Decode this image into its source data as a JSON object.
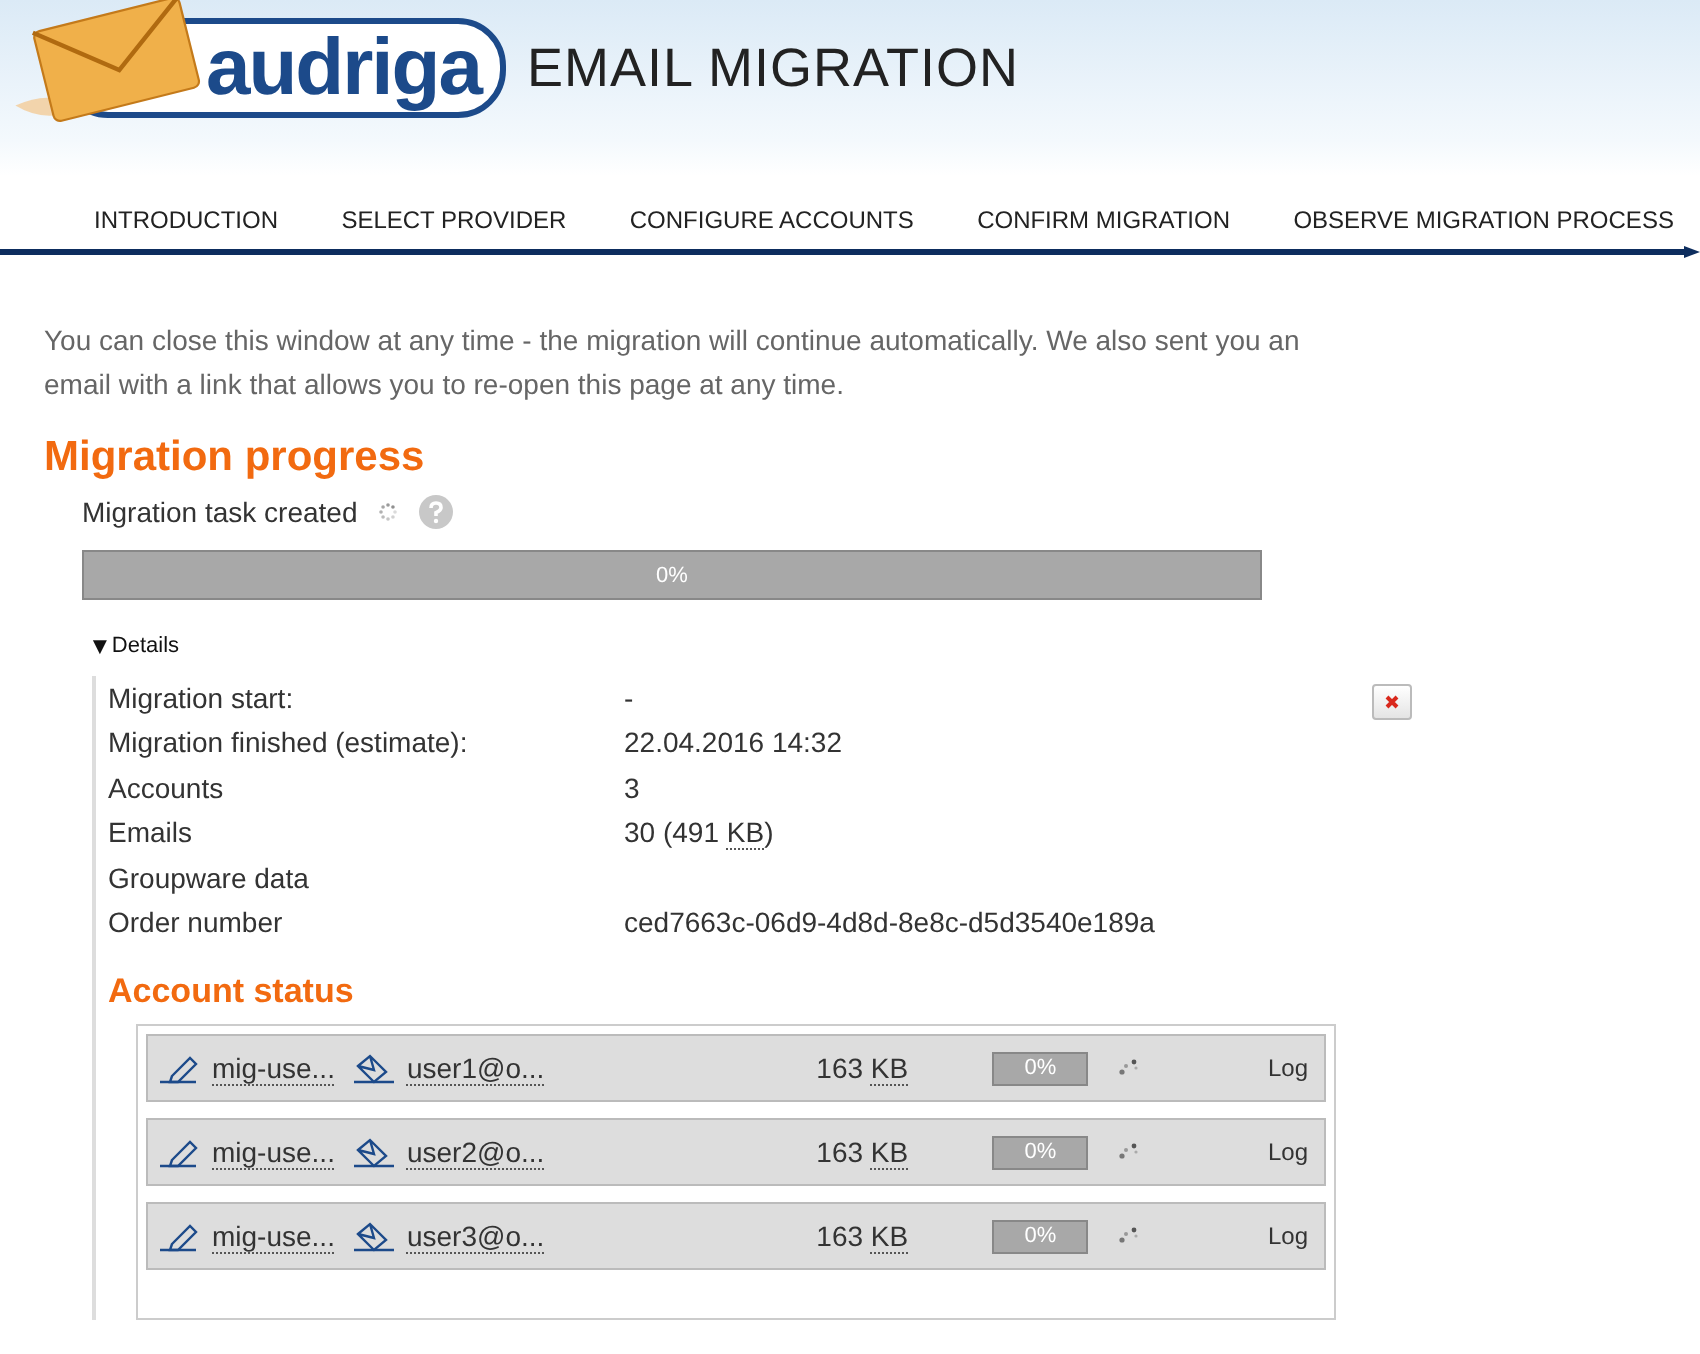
{
  "header": {
    "logo": "audriga",
    "title": "EMAIL MIGRATION"
  },
  "steps": [
    {
      "label": "INTRODUCTION"
    },
    {
      "label": "SELECT PROVIDER"
    },
    {
      "label": "CONFIGURE ACCOUNTS"
    },
    {
      "label": "CONFIRM MIGRATION"
    },
    {
      "label": "OBSERVE MIGRATION PROCESS"
    }
  ],
  "intro": "You can close this window at any time - the migration will continue automatically. We also sent you an email with a link that allows you to re-open this page at any time.",
  "progress": {
    "heading": "Migration progress",
    "status": "Migration task created",
    "level": 0,
    "reading": "0%"
  },
  "details": {
    "toggle": "▼",
    "label": "Details",
    "expanded": true,
    "rows": [
      {
        "label": "Migration start:",
        "value": "-"
      },
      {
        "label": "Migration finished (estimate):",
        "value": "22.04.2016 14:32"
      },
      {
        "label": "Accounts",
        "value": "3"
      },
      {
        "label": "Emails",
        "value": "30 (491",
        "unit": "KB",
        "suffix": ")"
      },
      {
        "label": "Groupware data",
        "value": ""
      },
      {
        "label": "Order number",
        "value": "ced7663c-06d9-4d8d-8e8c-d5d3540e189a"
      }
    ]
  },
  "account_status": {
    "heading": "Account status",
    "accounts": [
      {
        "source": "mig-use...",
        "target": "user1@o...",
        "size": "163",
        "unit": "KB",
        "level": 0,
        "reading": "0%",
        "log": "Log"
      },
      {
        "source": "mig-use...",
        "target": "user2@o...",
        "size": "163",
        "unit": "KB",
        "level": 0,
        "reading": "0%",
        "log": "Log"
      },
      {
        "source": "mig-use...",
        "target": "user3@o...",
        "size": "163",
        "unit": "KB",
        "level": 0,
        "reading": "0%",
        "log": "Log"
      }
    ]
  }
}
